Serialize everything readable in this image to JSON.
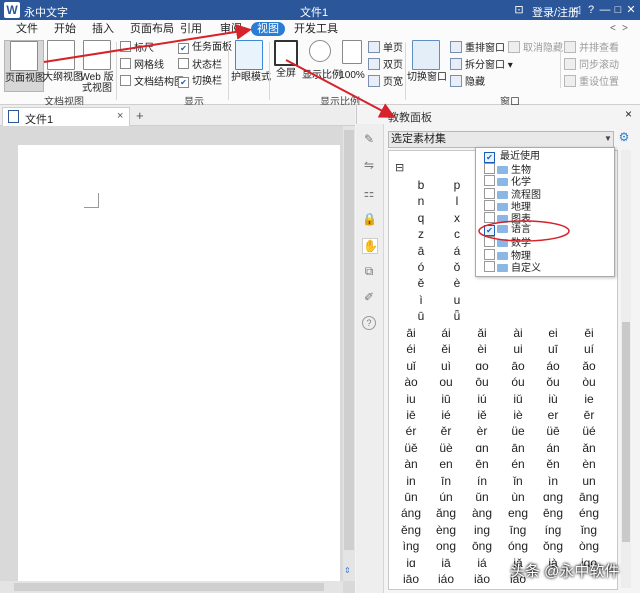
{
  "titlebar": {
    "logo": "W",
    "app_name": "永中文字",
    "doc_title": "文件1",
    "login": "登录/注册",
    "controls": [
      "⊡",
      "♡",
      "◁",
      "?",
      "—",
      "□",
      "✕"
    ]
  },
  "menu": {
    "tabs": [
      "文件",
      "开始",
      "插入",
      "页面布局",
      "引用",
      "审阅",
      "视图",
      "开发工具"
    ],
    "active": "视图",
    "right_icons": [
      "<",
      ">"
    ]
  },
  "ribbon": {
    "doc_view": {
      "buttons": [
        "页面视图",
        "大纲视图",
        "Web 版式视图"
      ],
      "group": "文档视图"
    },
    "show": {
      "checks": [
        {
          "label": "标尺",
          "checked": false
        },
        {
          "label": "网格线",
          "checked": false
        },
        {
          "label": "文档结构图",
          "checked": false
        },
        {
          "label": "任务面板",
          "checked": true
        },
        {
          "label": "状态栏",
          "checked": false
        },
        {
          "label": "切换栏",
          "checked": true
        }
      ],
      "group": "显示"
    },
    "eye_mode": "护眼模式",
    "zoom": {
      "buttons": [
        "全屏",
        "显示比例",
        "100%"
      ],
      "group": "显示比例"
    },
    "pages": [
      "单页",
      "双页",
      "页宽"
    ],
    "switch_window": "切换窗口",
    "window": {
      "items": [
        {
          "label": "重排窗口",
          "dim": false
        },
        {
          "label": "拆分窗口",
          "dim": false
        },
        {
          "label": "隐藏",
          "dim": false
        },
        {
          "label": "取消隐藏",
          "dim": true
        },
        {
          "label": "并排查看",
          "dim": true
        },
        {
          "label": "同步滚动",
          "dim": true
        },
        {
          "label": "重设位置",
          "dim": true
        }
      ],
      "group": "窗口"
    }
  },
  "document": {
    "tab_label": "文件1",
    "tab_close": "×",
    "new_tab": "+"
  },
  "panel": {
    "title": "教教面板",
    "close": "×",
    "combo_value": "选定素材集",
    "combo_arrow": "▼",
    "collapse": "⊟",
    "tree": [
      {
        "label": "最近使用",
        "checked": true,
        "folder": false
      },
      {
        "label": "生物",
        "checked": false,
        "folder": true
      },
      {
        "label": "化学",
        "checked": false,
        "folder": true
      },
      {
        "label": "流程图",
        "checked": false,
        "folder": true
      },
      {
        "label": "地理",
        "checked": false,
        "folder": true
      },
      {
        "label": "图表",
        "checked": false,
        "folder": true
      },
      {
        "label": "语言",
        "checked": true,
        "folder": true
      },
      {
        "label": "数学",
        "checked": false,
        "folder": true
      },
      {
        "label": "物理",
        "checked": false,
        "folder": true
      },
      {
        "label": "自定义",
        "checked": false,
        "folder": true
      }
    ],
    "letters_col1": [
      "b",
      "n",
      "q",
      "z",
      "ā",
      "ó",
      "ě",
      "ì",
      "ū"
    ],
    "letters_col2": [
      "p",
      "l",
      "x",
      "c",
      "á",
      "ǒ",
      "è",
      "u",
      "ǖ"
    ],
    "pinyin_rows": [
      [
        "āi",
        "ái",
        "ǎi",
        "ài",
        "ei",
        "ēi"
      ],
      [
        "éi",
        "ěi",
        "èi",
        "ui",
        "uī",
        "uí"
      ],
      [
        "uǐ",
        "uì",
        "ɑo",
        "āo",
        "áo",
        "ǎo"
      ],
      [
        "ào",
        "ou",
        "ōu",
        "óu",
        "ǒu",
        "òu"
      ],
      [
        "iu",
        "iū",
        "iú",
        "iǔ",
        "iù",
        "ie"
      ],
      [
        "iē",
        "ié",
        "iě",
        "iè",
        "er",
        "ēr"
      ],
      [
        "ér",
        "ěr",
        "èr",
        "üe",
        "üē",
        "üé"
      ],
      [
        "üě",
        "üè",
        "ɑn",
        "ān",
        "án",
        "ǎn"
      ],
      [
        "àn",
        "en",
        "ēn",
        "én",
        "ěn",
        "èn"
      ],
      [
        "in",
        "īn",
        "ín",
        "ǐn",
        "ìn",
        "un"
      ],
      [
        "ūn",
        "ún",
        "ǔn",
        "ùn",
        "ɑng",
        "āng"
      ],
      [
        "áng",
        "ǎng",
        "àng",
        "eng",
        "ēng",
        "éng"
      ],
      [
        "ěng",
        "èng",
        "ing",
        "īng",
        "íng",
        "ǐng"
      ],
      [
        "ìng",
        "ong",
        "ōng",
        "óng",
        "ǒng",
        "òng"
      ],
      [
        "iɑ",
        "iā",
        "iá",
        "iǎ",
        "ià",
        "iɑo"
      ],
      [
        "iāo",
        "iáo",
        "iǎo",
        "iào",
        "",
        ""
      ]
    ],
    "side_tools": [
      "✎",
      "⇋",
      "⚏",
      "🔒",
      "✋",
      "⧉",
      "✐",
      "?"
    ]
  },
  "watermark": "头条 @永中软件"
}
